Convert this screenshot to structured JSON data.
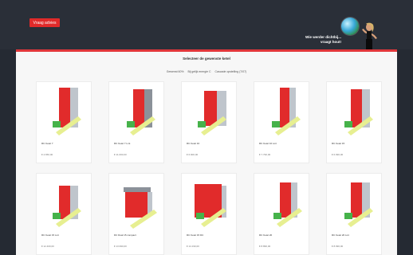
{
  "header": {
    "cta_label": "Vraag advies",
    "help_line1": "Wie werder dichtbij...",
    "help_line2": "vraagt hout!"
  },
  "panel": {
    "title": "Selecteer de gewenste ketel",
    "filters": [
      "Gewenst 60%",
      "Bij gelijk energie C",
      "Cascade opstelling (7/07)"
    ]
  },
  "products": [
    {
      "name": "RC Ketel 7",
      "price": "€ 4.650,00"
    },
    {
      "name": "RC Ketel 7 Lmt",
      "price": "€ 11.000,00"
    },
    {
      "name": "RC Ketel 10",
      "price": "€ 6.900,00"
    },
    {
      "name": "RC Ketel 10 Lmt",
      "price": "€ 7.790,00"
    },
    {
      "name": "RC Ketel 15",
      "price": "€ 6.990,00"
    },
    {
      "name": "RC Ketel 15 Lmt",
      "price": "€ 12.400,00"
    },
    {
      "name": "DC Dual 15 compact",
      "price": "€ 13.990,00"
    },
    {
      "name": "RC Ketel 15 DC",
      "price": "€ 14.190,00"
    },
    {
      "name": "RC Ketel 20",
      "price": "€ 8.890,00"
    },
    {
      "name": "RC Ketel 20 Lmt",
      "price": "€ 8.990,00"
    }
  ],
  "accent": "#e1373b"
}
